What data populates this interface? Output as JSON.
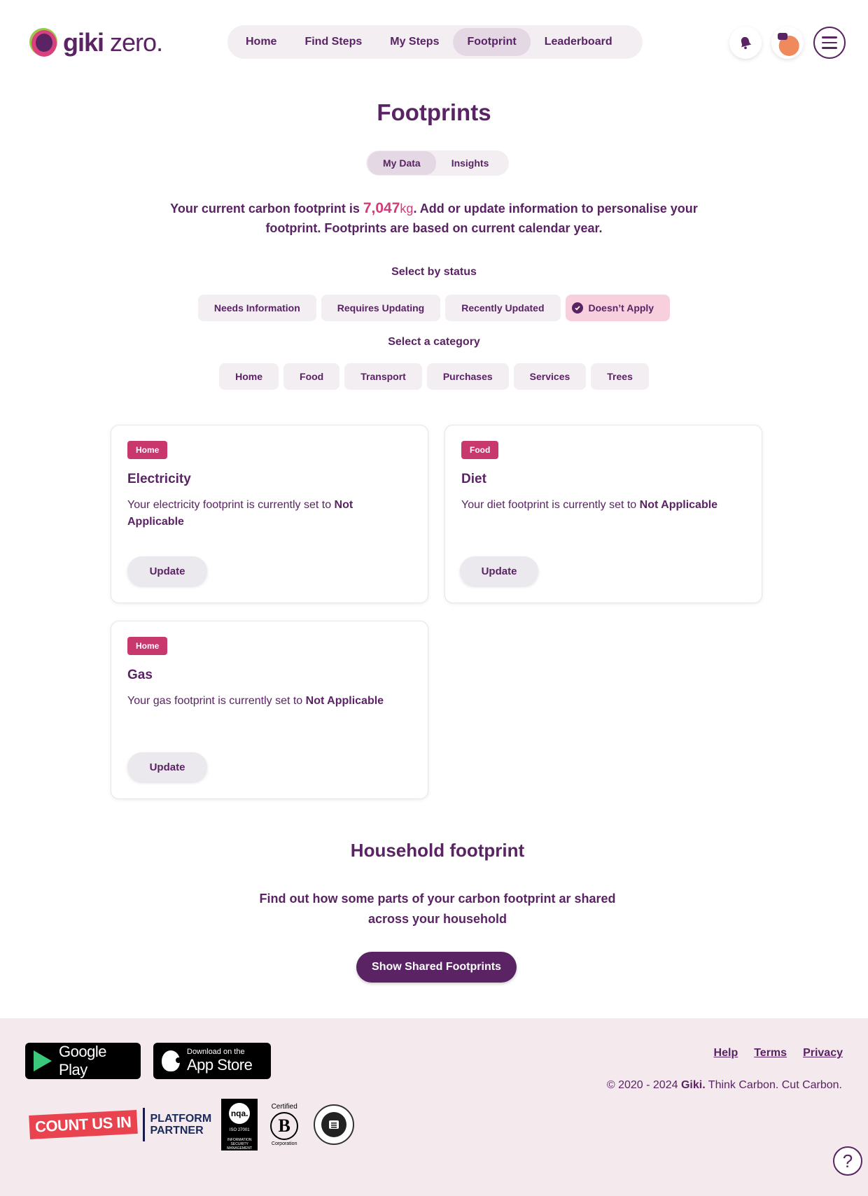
{
  "brand": {
    "name_bold": "giki",
    "name_light": "zero."
  },
  "nav": {
    "items": [
      {
        "label": "Home"
      },
      {
        "label": "Find Steps"
      },
      {
        "label": "My Steps"
      },
      {
        "label": "Footprint",
        "active": true
      },
      {
        "label": "Leaderboard"
      }
    ]
  },
  "header_icons": [
    "bell-icon",
    "avatar",
    "menu-icon"
  ],
  "page": {
    "title": "Footprints",
    "tabs": [
      {
        "label": "My Data",
        "active": true
      },
      {
        "label": "Insights"
      }
    ],
    "intro_before": "Your current carbon footprint is ",
    "footprint_value": "7,047",
    "footprint_unit": "kg",
    "intro_after": ". Add or update information to personalise your footprint. Footprints are based on current calendar year."
  },
  "status_filter": {
    "label": "Select by status",
    "options": [
      {
        "label": "Needs Information"
      },
      {
        "label": "Requires Updating"
      },
      {
        "label": "Recently Updated"
      },
      {
        "label": "Doesn’t Apply",
        "selected": true
      }
    ]
  },
  "category_filter": {
    "label": "Select a category",
    "options": [
      "Home",
      "Food",
      "Transport",
      "Purchases",
      "Services",
      "Trees"
    ]
  },
  "cards": [
    {
      "tag": "Home",
      "title": "Electricity",
      "text": "Your electricity footprint is currently set to ",
      "status": "Not Applicable",
      "button": "Update"
    },
    {
      "tag": "Food",
      "title": "Diet",
      "text": "Your diet footprint is currently set to ",
      "status": "Not Applicable",
      "button": "Update"
    },
    {
      "tag": "Home",
      "title": "Gas",
      "text": "Your gas footprint is currently set to ",
      "status": "Not Applicable",
      "button": "Update"
    }
  ],
  "household": {
    "title": "Household footprint",
    "text": "Find out how some parts of your carbon footprint ar shared across your household",
    "button": "Show Shared Footprints"
  },
  "footer": {
    "google_play": "Google Play",
    "app_store_small": "Download on the",
    "app_store_big": "App Store",
    "count_us_in": "COUNT US IN",
    "platform_partner_line1": "PLATFORM",
    "platform_partner_line2": "PARTNER",
    "nqa_logo": "nqa.",
    "nqa_text": "ISO 27001",
    "nqa_sub": "INFORMATION SECURITY MANAGEMENT",
    "bcorp_top": "Certified",
    "bcorp_letter": "B",
    "bcorp_bottom": "Corporation",
    "links": [
      "Help",
      "Terms",
      "Privacy"
    ],
    "copyright_before": "© 2020 - 2024 ",
    "copyright_brand": "Giki.",
    "copyright_after": " Think Carbon. Cut Carbon."
  },
  "colors": {
    "primary": "#5a2364",
    "accent": "#d33c78",
    "tag": "#c9386d",
    "footer_bg": "#f4e9ed"
  }
}
